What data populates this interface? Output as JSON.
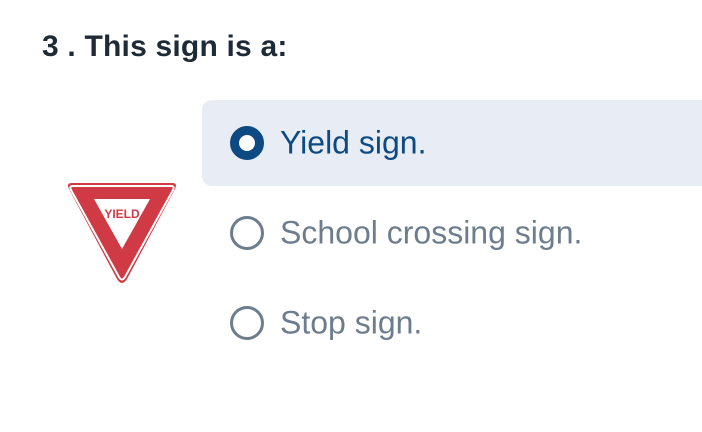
{
  "question": {
    "title": "3 . This sign is a:"
  },
  "sign": {
    "icon": "yield-sign-icon",
    "text": "YIELD",
    "color": "#cf3a45"
  },
  "options": [
    {
      "label": "Yield sign.",
      "selected": true
    },
    {
      "label": "School crossing sign.",
      "selected": false
    },
    {
      "label": "Stop sign.",
      "selected": false
    }
  ],
  "colors": {
    "accent": "#0d4a82",
    "selected_background": "#e8edf5",
    "muted_text": "#6e7d8e",
    "title_text": "#1f2a37"
  }
}
